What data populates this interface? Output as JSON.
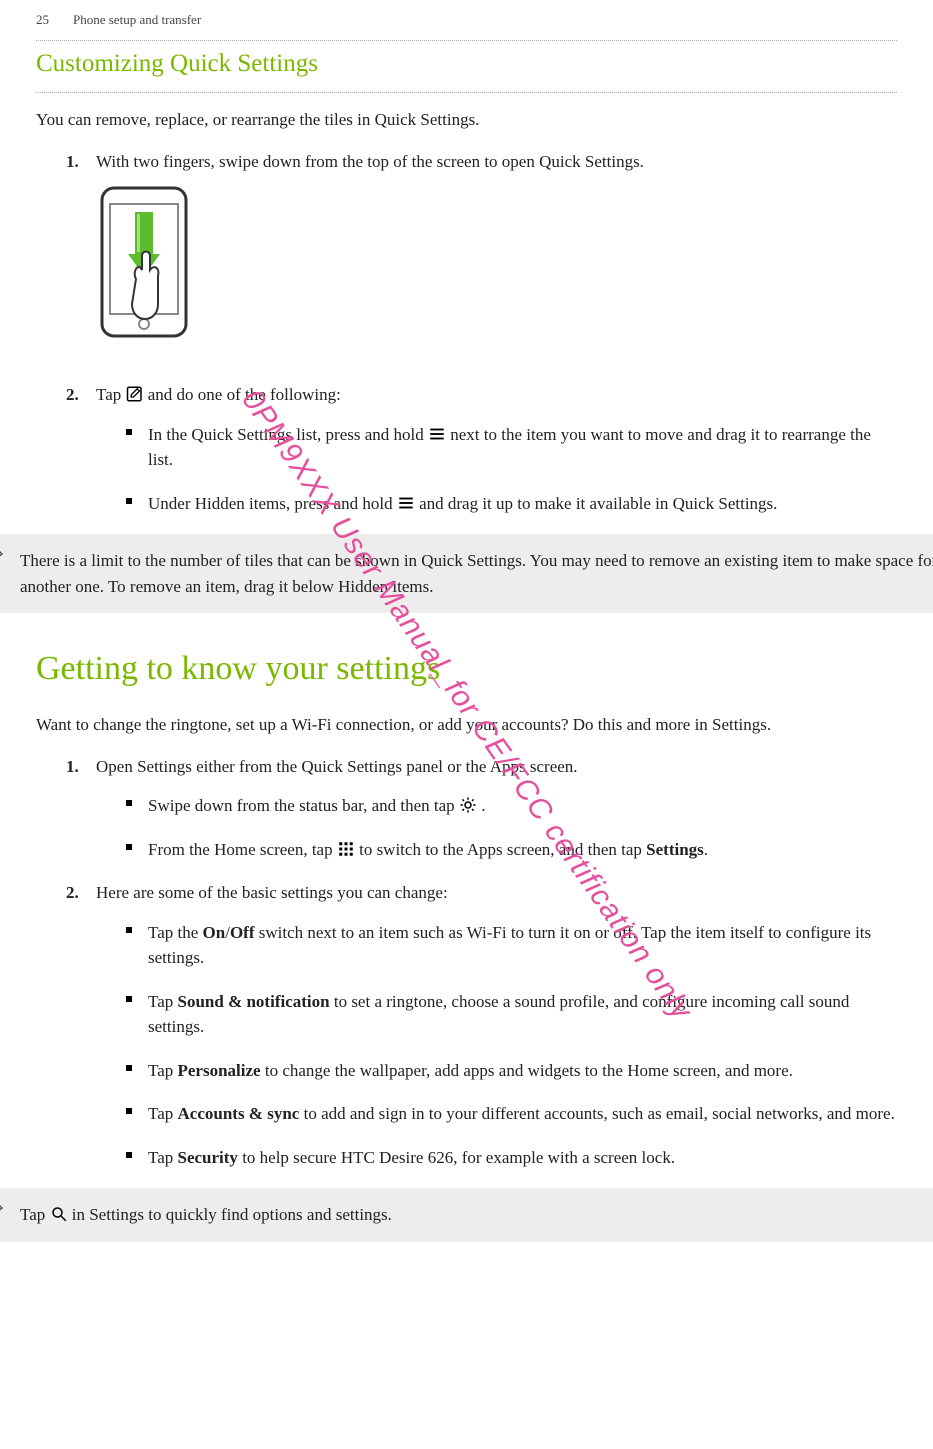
{
  "header": {
    "pageNumber": "25",
    "section": "Phone setup and transfer"
  },
  "customizing": {
    "title": "Customizing Quick Settings",
    "intro": "You can remove, replace, or rearrange the tiles in Quick Settings.",
    "step1_num": "1.",
    "step1_text": "With two fingers, swipe down from the top of the screen to open Quick Settings.",
    "step2_num": "2.",
    "step2_a": "Tap ",
    "step2_b": " and do one of the following:",
    "bullet1_a": "In the Quick Settings list, press and hold ",
    "bullet1_b": " next to the item you want to move and drag it to rearrange the list.",
    "bullet2_a": "Under Hidden items, press and hold ",
    "bullet2_b": " and drag it up to make it available in Quick Settings.",
    "note": "There is a limit to the number of tiles that can be shown in Quick Settings. You may need to remove an existing item to make space for another one. To remove an item, drag it below Hidden items."
  },
  "settings": {
    "heading": "Getting to know your settings",
    "intro": "Want to change the ringtone, set up a Wi-Fi connection, or add your accounts? Do this and more in Settings.",
    "step1_num": "1.",
    "step1_text": "Open Settings either from the Quick Settings panel or the Apps screen.",
    "s1_b1_a": "Swipe down from the status bar, and then tap ",
    "s1_b1_b": " .",
    "s1_b2_a": "From the Home screen, tap ",
    "s1_b2_b": " to switch to the Apps screen, and then tap ",
    "s1_b2_c": "Settings",
    "s1_b2_d": ".",
    "step2_num": "2.",
    "step2_text": "Here are some of the basic settings you can change:",
    "s2_b1_a": "Tap the ",
    "s2_b1_b": "On",
    "s2_b1_c": "/",
    "s2_b1_d": "Off",
    "s2_b1_e": " switch next to an item such as Wi-Fi to turn it on or off. Tap the item itself to configure its settings.",
    "s2_b2_a": "Tap ",
    "s2_b2_b": "Sound & notification",
    "s2_b2_c": " to set a ringtone, choose a sound profile, and configure incoming call sound settings.",
    "s2_b3_a": "Tap ",
    "s2_b3_b": "Personalize",
    "s2_b3_c": " to change the wallpaper, add apps and widgets to the Home screen, and more.",
    "s2_b4_a": "Tap ",
    "s2_b4_b": "Accounts & sync",
    "s2_b4_c": " to add and sign in to your different accounts, such as email, social networks, and more.",
    "s2_b5_a": "Tap ",
    "s2_b5_b": "Security",
    "s2_b5_c": " to help secure HTC Desire 626, for example with a screen lock.",
    "tip_a": "Tap ",
    "tip_b": " in Settings to quickly find options and settings."
  },
  "watermark": "0PM9XXX User Manual_for CE/FCC certification only"
}
